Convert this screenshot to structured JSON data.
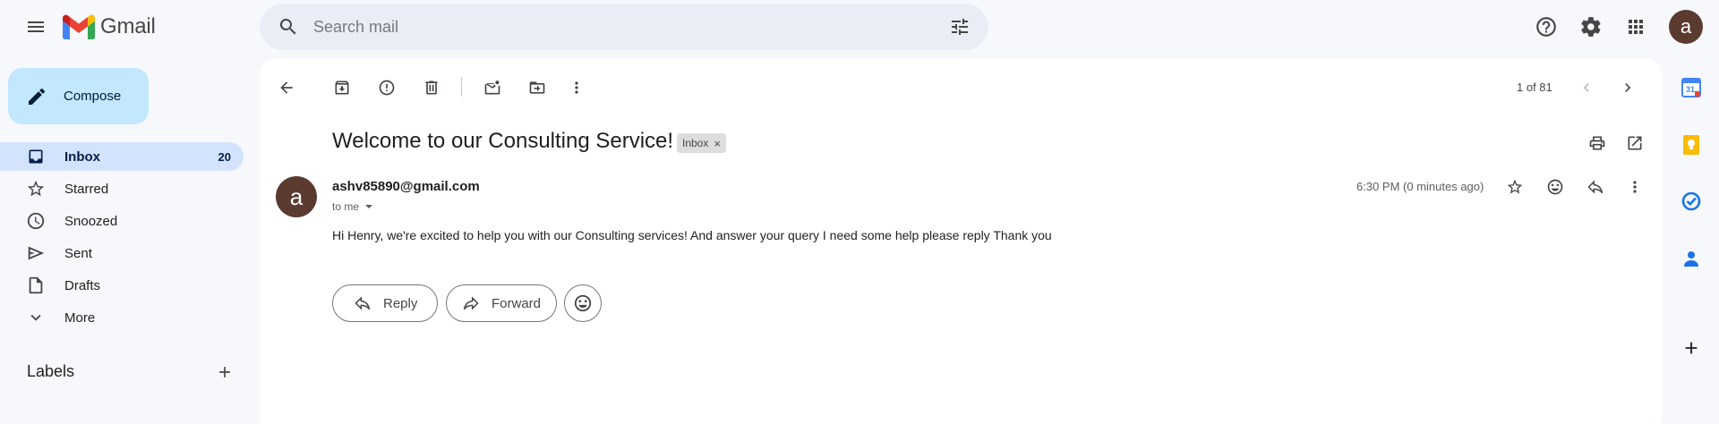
{
  "app": {
    "name": "Gmail"
  },
  "header": {
    "search_placeholder": "Search mail",
    "avatar_letter": "a",
    "icons": [
      "menu-icon",
      "search-icon",
      "tune-icon",
      "help-icon",
      "settings-icon",
      "apps-icon"
    ]
  },
  "sidebar": {
    "compose_label": "Compose",
    "items": [
      {
        "label": "Inbox",
        "count": "20",
        "icon": "inbox-icon",
        "active": true
      },
      {
        "label": "Starred",
        "count": "",
        "icon": "star-icon"
      },
      {
        "label": "Snoozed",
        "count": "",
        "icon": "clock-icon"
      },
      {
        "label": "Sent",
        "count": "",
        "icon": "send-icon"
      },
      {
        "label": "Drafts",
        "count": "",
        "icon": "draft-icon"
      },
      {
        "label": "More",
        "count": "",
        "icon": "chevron-down-icon"
      }
    ],
    "labels_title": "Labels"
  },
  "toolbar": {
    "pager": "1 of 81",
    "icons": [
      "back-arrow-icon",
      "archive-icon",
      "report-spam-icon",
      "delete-icon",
      "mark-unread-icon",
      "move-to-icon",
      "more-vert-icon",
      "chevron-left-icon",
      "chevron-right-icon"
    ]
  },
  "email": {
    "subject": "Welcome to our Consulting Service!",
    "label_chip": "Inbox",
    "sender": "ashv85890@gmail.com",
    "sender_avatar_letter": "a",
    "recipient": "to me",
    "time": "6:30 PM (0 minutes ago)",
    "body": "Hi Henry, we're excited to help you with our Consulting services! And answer your query I need some help please reply Thank you",
    "reply_label": "Reply",
    "forward_label": "Forward"
  },
  "side_panel": {
    "icons": [
      "calendar-icon",
      "keep-icon",
      "tasks-icon",
      "contacts-icon",
      "add-icon"
    ],
    "calendar_day": "31"
  },
  "colors": {
    "active_nav": "#d3e3fd",
    "compose": "#c2e7ff",
    "avatar": "#5b3a30",
    "background": "#f6f8fc"
  }
}
